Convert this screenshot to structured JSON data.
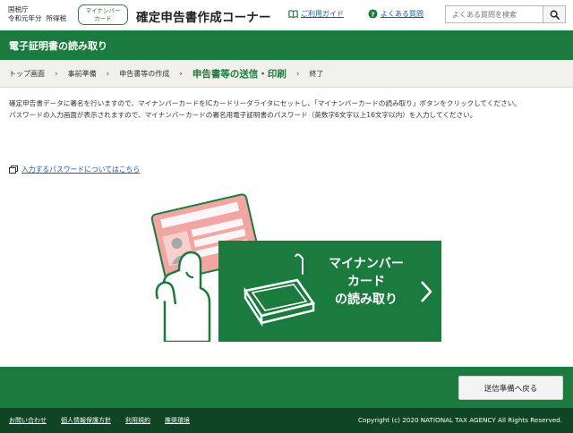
{
  "header": {
    "agency_name": "国税庁",
    "fiscal_year": "令和元年分",
    "tax_type": "所得税",
    "mynumber_badge_line1": "マイナンバー",
    "mynumber_badge_line2": "カード",
    "site_title": "確定申告書作成コーナー",
    "guide_link": "ご利用ガイド",
    "faq_link": "よくある質問",
    "search_placeholder": "よくある質問を検索"
  },
  "page": {
    "title": "電子証明書の読み取り"
  },
  "steps": [
    {
      "label": "トップ画面",
      "current": false
    },
    {
      "label": "事前準備",
      "current": false
    },
    {
      "label": "申告書等の作成",
      "current": false
    },
    {
      "label": "申告書等の送信・印刷",
      "current": true
    },
    {
      "label": "終了",
      "current": false
    }
  ],
  "instructions": {
    "paragraph1": "確定申告書データに署名を行いますので、マイナンバーカードをICカードリーダライタにセットし、「マイナンバーカードの読み取り」ボタンをクリックしてください。",
    "paragraph2": "パスワードの入力画面が表示されますので、マイナンバーカードの署名用電子証明書のパスワード（英数字6文字以上16文字以内）を入力してください。"
  },
  "password_link": "入力するパスワードについてはこちら",
  "reader_button": {
    "line1": "マイナンバー",
    "line2": "カード",
    "line3": "の読み取り"
  },
  "actions": {
    "back_label": "送信準備へ戻る"
  },
  "footer": {
    "links": [
      "お問い合わせ",
      "個人情報保護方針",
      "利用規約",
      "推奨環境"
    ],
    "copyright": "Copyright (c) 2020 NATIONAL TAX AGENCY All Rights Reserved."
  },
  "colors": {
    "primary_green": "#1b7a3d",
    "footer_green": "#0f4524",
    "link_blue": "#1a5ea8",
    "card_pink": "#f2a6a3"
  }
}
